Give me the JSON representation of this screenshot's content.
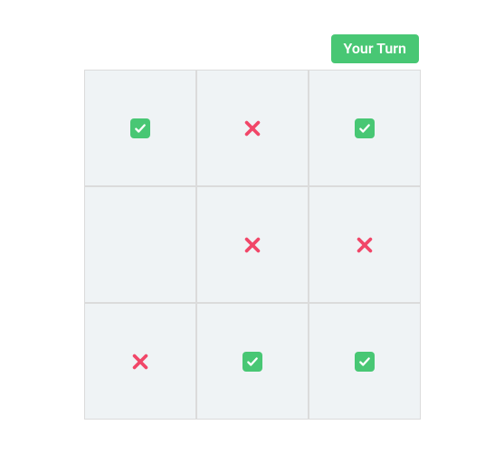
{
  "status": {
    "label": "Your Turn"
  },
  "colors": {
    "check_bg": "#48c774",
    "x_color": "#f14668",
    "cell_bg": "#eff3f5",
    "cell_border": "#dbdbdb"
  },
  "board": {
    "rows": 3,
    "cols": 3,
    "cells": [
      "check",
      "x",
      "check",
      "",
      "x",
      "x",
      "x",
      "check",
      "check"
    ]
  }
}
